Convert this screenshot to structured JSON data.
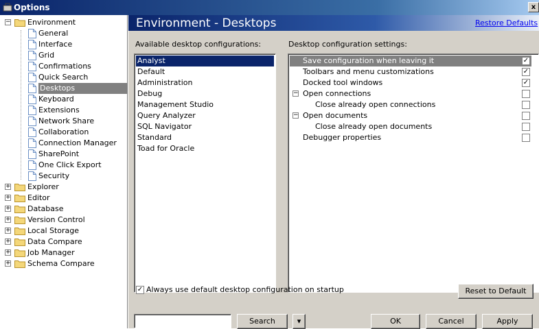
{
  "window": {
    "title": "Options",
    "close_glyph": "x"
  },
  "tree": {
    "environment": {
      "label": "Environment",
      "children": [
        "General",
        "Interface",
        "Grid",
        "Confirmations",
        "Quick Search",
        "Desktops",
        "Keyboard",
        "Extensions",
        "Network Share",
        "Collaboration",
        "Connection Manager",
        "SharePoint",
        "One Click Export",
        "Security"
      ],
      "selected": "Desktops"
    },
    "roots": [
      "Explorer",
      "Editor",
      "Database",
      "Version Control",
      "Local Storage",
      "Data Compare",
      "Job Manager",
      "Schema Compare"
    ],
    "expand_glyph": "+",
    "collapse_glyph": "−"
  },
  "header": {
    "title": "Environment - Desktops",
    "restore_link": "Restore Defaults"
  },
  "available": {
    "label": "Available desktop configurations:",
    "items": [
      "Analyst",
      "Default",
      "Administration",
      "Debug",
      "Management Studio",
      "Query Analyzer",
      "SQL Navigator",
      "Standard",
      "Toad for Oracle"
    ],
    "selected_index": 0
  },
  "settings": {
    "label": "Desktop configuration settings:",
    "rows": [
      {
        "label": "Save configuration when leaving it",
        "checked": true,
        "level": 0,
        "group": false,
        "selected": true
      },
      {
        "label": "Toolbars and menu customizations",
        "checked": true,
        "level": 0,
        "group": false,
        "selected": false
      },
      {
        "label": "Docked tool windows",
        "checked": true,
        "level": 0,
        "group": false,
        "selected": false
      },
      {
        "label": "Open connections",
        "checked": false,
        "level": 0,
        "group": true,
        "selected": false
      },
      {
        "label": "Close already open connections",
        "checked": false,
        "level": 1,
        "group": false,
        "selected": false
      },
      {
        "label": "Open documents",
        "checked": false,
        "level": 0,
        "group": true,
        "selected": false
      },
      {
        "label": "Close already open documents",
        "checked": false,
        "level": 1,
        "group": false,
        "selected": false
      },
      {
        "label": "Debugger properties",
        "checked": false,
        "level": 0,
        "group": false,
        "selected": false
      }
    ],
    "check_glyph": "✓"
  },
  "footer": {
    "always_default_label": "Always use default desktop configuration on startup",
    "always_default_checked": true,
    "reset_button": "Reset to Default",
    "search_value": "",
    "search_button": "Search",
    "dropdown_glyph": "▾",
    "ok_button": "OK",
    "cancel_button": "Cancel",
    "apply_button": "Apply"
  },
  "colors": {
    "selection": "#0a246a",
    "gray_selection": "#808080",
    "panel_bg": "#d4d0c8",
    "link": "#0000ee"
  }
}
